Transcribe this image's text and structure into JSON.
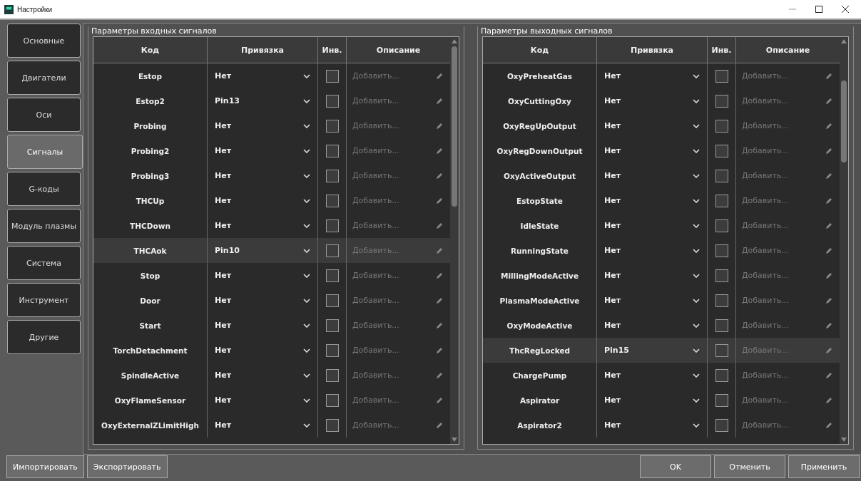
{
  "window": {
    "title": "Настройки"
  },
  "sidebar": {
    "tabs": [
      {
        "label": "Основные",
        "selected": false
      },
      {
        "label": "Двигатели",
        "selected": false
      },
      {
        "label": "Оси",
        "selected": false
      },
      {
        "label": "Сигналы",
        "selected": true
      },
      {
        "label": "G-коды",
        "selected": false
      },
      {
        "label": "Модуль плазмы",
        "selected": false
      },
      {
        "label": "Система",
        "selected": false
      },
      {
        "label": "Инструмент",
        "selected": false
      },
      {
        "label": "Другие",
        "selected": false
      }
    ]
  },
  "panels": [
    {
      "title": "Параметры входных сигналов",
      "columns": [
        "Код",
        "Привязка",
        "Инв.",
        "Описание"
      ],
      "rows": [
        {
          "code": "Estop",
          "binding": "Нет",
          "inverted": false,
          "placeholder": "Добавить...",
          "selected": false
        },
        {
          "code": "Estop2",
          "binding": "Pin13",
          "inverted": false,
          "placeholder": "Добавить...",
          "selected": false
        },
        {
          "code": "Probing",
          "binding": "Нет",
          "inverted": false,
          "placeholder": "Добавить...",
          "selected": false
        },
        {
          "code": "Probing2",
          "binding": "Нет",
          "inverted": false,
          "placeholder": "Добавить...",
          "selected": false
        },
        {
          "code": "Probing3",
          "binding": "Нет",
          "inverted": false,
          "placeholder": "Добавить...",
          "selected": false
        },
        {
          "code": "THCUp",
          "binding": "Нет",
          "inverted": false,
          "placeholder": "Добавить...",
          "selected": false
        },
        {
          "code": "THCDown",
          "binding": "Нет",
          "inverted": false,
          "placeholder": "Добавить...",
          "selected": false
        },
        {
          "code": "THCAok",
          "binding": "Pin10",
          "inverted": false,
          "placeholder": "Добавить...",
          "selected": true
        },
        {
          "code": "Stop",
          "binding": "Нет",
          "inverted": false,
          "placeholder": "Добавить...",
          "selected": false
        },
        {
          "code": "Door",
          "binding": "Нет",
          "inverted": false,
          "placeholder": "Добавить...",
          "selected": false
        },
        {
          "code": "Start",
          "binding": "Нет",
          "inverted": false,
          "placeholder": "Добавить...",
          "selected": false
        },
        {
          "code": "TorchDetachment",
          "binding": "Нет",
          "inverted": false,
          "placeholder": "Добавить...",
          "selected": false
        },
        {
          "code": "SpindleActive",
          "binding": "Нет",
          "inverted": false,
          "placeholder": "Добавить...",
          "selected": false
        },
        {
          "code": "OxyFlameSensor",
          "binding": "Нет",
          "inverted": false,
          "placeholder": "Добавить...",
          "selected": false
        },
        {
          "code": "OxyExternalZLimitHigh",
          "binding": "Нет",
          "inverted": false,
          "placeholder": "Добавить...",
          "selected": false
        }
      ]
    },
    {
      "title": "Параметры выходных сигналов",
      "columns": [
        "Код",
        "Привязка",
        "Инв.",
        "Описание"
      ],
      "rows": [
        {
          "code": "OxyPreheatGas",
          "binding": "Нет",
          "inverted": false,
          "placeholder": "Добавить...",
          "selected": false
        },
        {
          "code": "OxyCuttingOxy",
          "binding": "Нет",
          "inverted": false,
          "placeholder": "Добавить...",
          "selected": false
        },
        {
          "code": "OxyRegUpOutput",
          "binding": "Нет",
          "inverted": false,
          "placeholder": "Добавить...",
          "selected": false
        },
        {
          "code": "OxyRegDownOutput",
          "binding": "Нет",
          "inverted": false,
          "placeholder": "Добавить...",
          "selected": false
        },
        {
          "code": "OxyActiveOutput",
          "binding": "Нет",
          "inverted": false,
          "placeholder": "Добавить...",
          "selected": false
        },
        {
          "code": "EstopState",
          "binding": "Нет",
          "inverted": false,
          "placeholder": "Добавить...",
          "selected": false
        },
        {
          "code": "IdleState",
          "binding": "Нет",
          "inverted": false,
          "placeholder": "Добавить...",
          "selected": false
        },
        {
          "code": "RunningState",
          "binding": "Нет",
          "inverted": false,
          "placeholder": "Добавить...",
          "selected": false
        },
        {
          "code": "MillingModeActive",
          "binding": "Нет",
          "inverted": false,
          "placeholder": "Добавить...",
          "selected": false
        },
        {
          "code": "PlasmaModeActive",
          "binding": "Нет",
          "inverted": false,
          "placeholder": "Добавить...",
          "selected": false
        },
        {
          "code": "OxyModeActive",
          "binding": "Нет",
          "inverted": false,
          "placeholder": "Добавить...",
          "selected": false
        },
        {
          "code": "ThcRegLocked",
          "binding": "Pin15",
          "inverted": false,
          "placeholder": "Добавить...",
          "selected": true
        },
        {
          "code": "ChargePump",
          "binding": "Нет",
          "inverted": false,
          "placeholder": "Добавить...",
          "selected": false
        },
        {
          "code": "Aspirator",
          "binding": "Нет",
          "inverted": false,
          "placeholder": "Добавить...",
          "selected": false
        },
        {
          "code": "Aspirator2",
          "binding": "Нет",
          "inverted": false,
          "placeholder": "Добавить...",
          "selected": false
        }
      ]
    }
  ],
  "footer": {
    "left_buttons": [
      "Импортировать",
      "Экспортировать"
    ],
    "right_buttons": [
      "OK",
      "Отменить",
      "Применить"
    ]
  }
}
